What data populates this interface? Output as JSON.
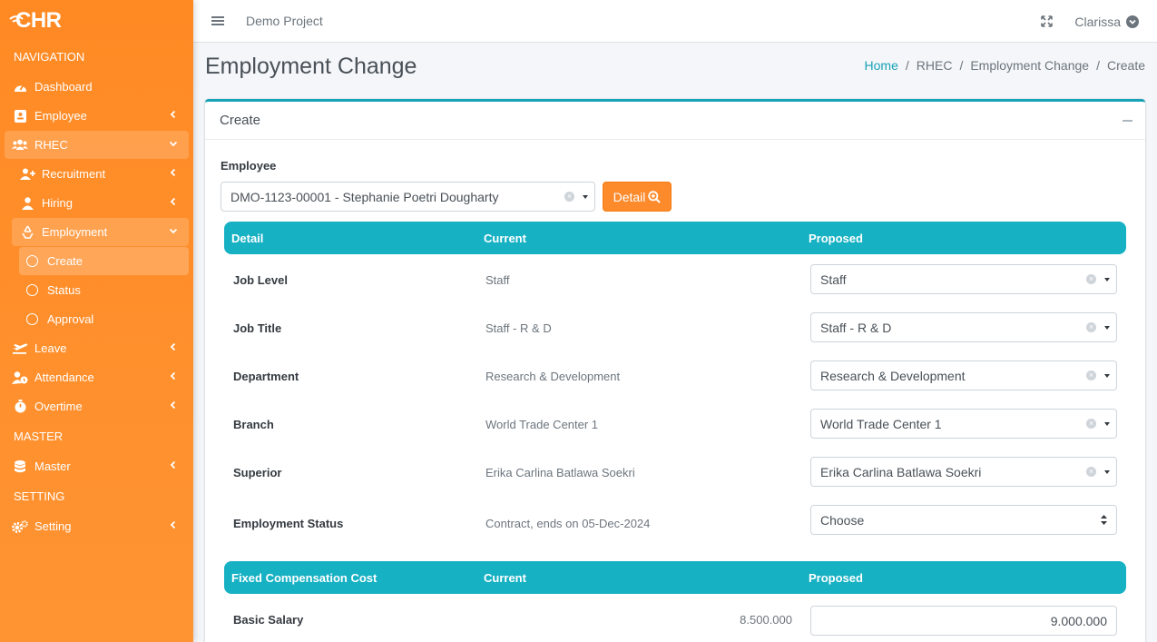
{
  "brand": {
    "name": "CHR"
  },
  "sidebar": {
    "headers": {
      "navigation": "NAVIGATION",
      "master": "MASTER",
      "setting": "SETTING"
    },
    "items": {
      "dashboard": "Dashboard",
      "employee": "Employee",
      "rhec": "RHEC",
      "recruitment": "Recruitment",
      "hiring": "Hiring",
      "employment": "Employment",
      "create": "Create",
      "status": "Status",
      "approval": "Approval",
      "leave": "Leave",
      "attendance": "Attendance",
      "overtime": "Overtime",
      "master": "Master",
      "setting": "Setting"
    }
  },
  "topbar": {
    "project": "Demo Project",
    "user": "Clarissa"
  },
  "page": {
    "title": "Employment Change"
  },
  "breadcrumb": {
    "home": "Home",
    "rhec": "RHEC",
    "employment_change": "Employment Change",
    "create": "Create"
  },
  "card": {
    "title": "Create",
    "employee_label": "Employee",
    "employee_value": "DMO-1123-00001 - Stephanie Poetri Dougharty",
    "detail_button": "Detail"
  },
  "detail_table": {
    "headers": {
      "detail": "Detail",
      "current": "Current",
      "proposed": "Proposed"
    },
    "rows": [
      {
        "label": "Job Level",
        "current": "Staff",
        "proposed": "Staff"
      },
      {
        "label": "Job Title",
        "current": "Staff - R & D",
        "proposed": "Staff - R & D"
      },
      {
        "label": "Department",
        "current": "Research & Development",
        "proposed": "Research & Development"
      },
      {
        "label": "Branch",
        "current": "World Trade Center 1",
        "proposed": "World Trade Center 1"
      },
      {
        "label": "Superior",
        "current": "Erika Carlina Batlawa Soekri",
        "proposed": "Erika Carlina Batlawa Soekri"
      },
      {
        "label": "Employment Status",
        "current": "Contract, ends on 05-Dec-2024",
        "proposed": "Choose"
      }
    ]
  },
  "compensation_table": {
    "headers": {
      "detail": "Fixed Compensation Cost",
      "current": "Current",
      "proposed": "Proposed"
    },
    "rows": [
      {
        "label": "Basic Salary",
        "current": "8.500.000",
        "proposed": "9.000.000"
      }
    ]
  },
  "colors": {
    "sidebar": "#ff8a24",
    "accent": "#17b1c4",
    "button": "#fd8a2b"
  }
}
